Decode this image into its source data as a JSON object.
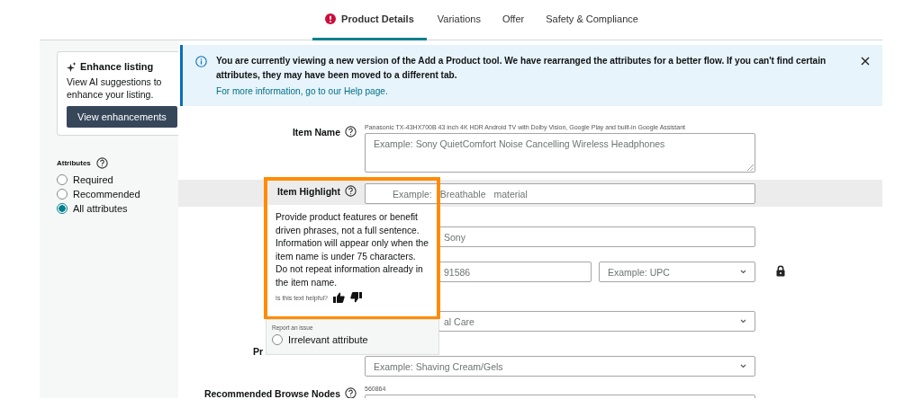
{
  "tabs": [
    {
      "label": "Product Details",
      "selected": true,
      "error": true
    },
    {
      "label": "Variations",
      "selected": false,
      "error": false
    },
    {
      "label": "Offer",
      "selected": false,
      "error": false
    },
    {
      "label": "Safety & Compliance",
      "selected": false,
      "error": false
    }
  ],
  "sidebar": {
    "enhance": {
      "title": "Enhance listing",
      "text": "View AI suggestions to enhance your listing.",
      "button": "View enhancements"
    },
    "attributes": {
      "label": "Attributes",
      "options": [
        {
          "label": "Required",
          "selected": false
        },
        {
          "label": "Recommended",
          "selected": false
        },
        {
          "label": "All attributes",
          "selected": true
        }
      ]
    }
  },
  "banner": {
    "message": "You are currently viewing a new version of the Add a Product tool. We have rearranged the attributes for a better flow. If you can't find certain attributes, they may have been moved to a different tab.",
    "link": "For more information, go to our Help page."
  },
  "form": {
    "rows": [
      {
        "label": "Item Name",
        "help": true,
        "hint": "Panasonic TX-43HX700B 43 inch 4K HDR Android TV with Dolby Vision, Google Play and built-in Google Assistant",
        "highlighted": false,
        "locked": false,
        "fields": [
          {
            "kind": "textarea",
            "placeholder": "Example: Sony QuietComfort Noise Cancelling Wireless Headphones"
          }
        ]
      },
      {
        "label": "Item Highlight",
        "help": true,
        "highlighted": true,
        "locked": false,
        "fields": [
          {
            "kind": "input",
            "placeholder": "Example: Breathable material"
          }
        ]
      },
      {
        "highlighted": false,
        "locked": false,
        "fields": [
          {
            "kind": "input",
            "placeholder": "Sony",
            "covered": true
          }
        ]
      },
      {
        "highlighted": false,
        "locked": true,
        "fields": [
          {
            "kind": "input",
            "placeholder": "91586",
            "covered": true
          },
          {
            "kind": "select",
            "placeholder": "Example: UPC"
          }
        ]
      },
      {
        "highlighted": false,
        "locked": false,
        "fields": [
          {
            "kind": "select",
            "placeholder": "al Care",
            "covered": true
          }
        ]
      },
      {
        "label": "Pr",
        "help": false,
        "highlighted": false,
        "locked": false,
        "fields": [
          {
            "kind": "select",
            "placeholder": "Example: Shaving Cream/Gels"
          }
        ]
      },
      {
        "label": "Recommended Browse Nodes",
        "help": true,
        "hint": "560864",
        "highlighted": false,
        "locked": false,
        "fields": [
          {
            "kind": "input"
          }
        ]
      }
    ]
  },
  "popover": {
    "text": "Provide product features or benefit driven phrases, not a full sentence. Information will appear only when the item name is under 75 characters. Do not repeat information already in the item name.",
    "feedback": "Is this text helpful?",
    "report": {
      "label": "Report an issue",
      "options": [
        {
          "label": "Irrelevant attribute",
          "selected": false
        }
      ]
    }
  }
}
